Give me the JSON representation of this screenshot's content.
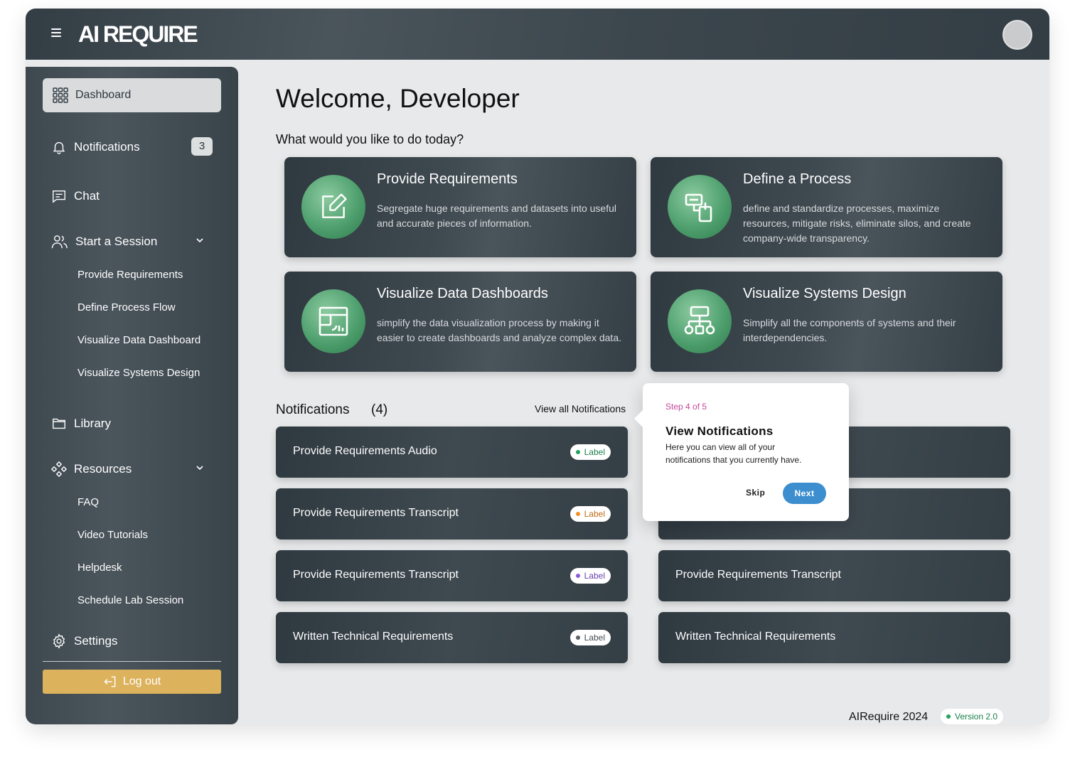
{
  "app": {
    "title": "AI REQUIRE"
  },
  "sidebar": {
    "dashboard": "Dashboard",
    "notifications": {
      "label": "Notifications",
      "count": "3"
    },
    "chat": "Chat",
    "start_session": {
      "label": "Start a Session",
      "items": [
        "Provide Requirements",
        "Define Process Flow",
        "Visualize Data Dashboard",
        "Visualize Systems Design"
      ]
    },
    "library": "Library",
    "resources": {
      "label": "Resources",
      "items": [
        "FAQ",
        "Video Tutorials",
        "Helpdesk",
        "Schedule Lab Session"
      ]
    },
    "settings": "Settings",
    "logout": "Log out"
  },
  "main": {
    "welcome": "Welcome, Developer",
    "question": "What would you like to do today?",
    "cards": [
      {
        "title": "Provide Requirements",
        "desc": "Segregate huge requirements and datasets into useful and accurate pieces of information.",
        "icon": "edit-icon"
      },
      {
        "title": "Define a Process",
        "desc": "define and standardize processes, maximize resources, mitigate risks, eliminate silos, and create company-wide transparency.",
        "icon": "process-icon"
      },
      {
        "title": "Visualize Data Dashboards",
        "desc": "simplify the data visualization process by making it easier to create dashboards and analyze complex data.",
        "icon": "dashboard-chart-icon"
      },
      {
        "title": "Visualize Systems Design",
        "desc": "Simplify all the components of systems and their interdependencies.",
        "icon": "hierarchy-icon"
      }
    ],
    "notifications": {
      "heading": "Notifications",
      "count": "(4)",
      "view_all": "View all Notifications",
      "left": [
        {
          "text": "Provide Requirements Audio",
          "label": "Label",
          "label_color": "#1a7f4b",
          "dot": "#22a35d"
        },
        {
          "text": "Provide Requirements Transcript",
          "label": "Label",
          "label_color": "#c06a12",
          "dot": "#f0902a"
        },
        {
          "text": "Provide Requirements Transcript",
          "label": "Label",
          "label_color": "#6a3fb0",
          "dot": "#8a5cd6"
        },
        {
          "text": "Written Technical Requirements",
          "label": "Label",
          "label_color": "#444b52",
          "dot": "#5a6167"
        }
      ],
      "right": [
        {
          "text": ""
        },
        {
          "text": ""
        },
        {
          "text": "Provide Requirements Transcript"
        },
        {
          "text": "Written Technical Requirements"
        }
      ]
    },
    "footer": {
      "text": "AIRequire 2024",
      "version": "Version 2.0"
    }
  },
  "tour": {
    "step": "Step 4 of 5",
    "title": "View Notifications",
    "body": "Here you can view all of your notifications that you currently have.",
    "skip": "Skip",
    "next": "Next"
  }
}
